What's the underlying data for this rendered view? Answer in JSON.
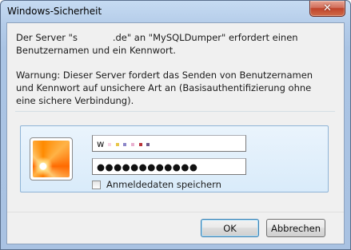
{
  "window": {
    "title": "Windows-Sicherheit",
    "close_glyph": "✕"
  },
  "message": {
    "line1": "Der Server \"s            .de\" an \"MySQLDumper\" erfordert einen Benutzernamen und ein Kennwort.",
    "warning": "Warnung: Dieser Server fordert das Senden von Benutzernamen und Kennwort auf unsichere Art an (Basisauthentifizierung ohne eine sichere Verbindung)."
  },
  "credentials": {
    "username_value": "w",
    "password_value": "●●●●●●●●●●●●",
    "remember_label": "Anmeldedaten speichern",
    "remember_checked": false
  },
  "buttons": {
    "ok": "OK",
    "cancel": "Abbrechen"
  },
  "colors": {
    "accent": "#3c7fb1",
    "panel_bg": "#d9ebfa",
    "close_red": "#c0442b"
  },
  "icons": {
    "avatar": "user-avatar-flower-icon",
    "close": "close-icon"
  }
}
